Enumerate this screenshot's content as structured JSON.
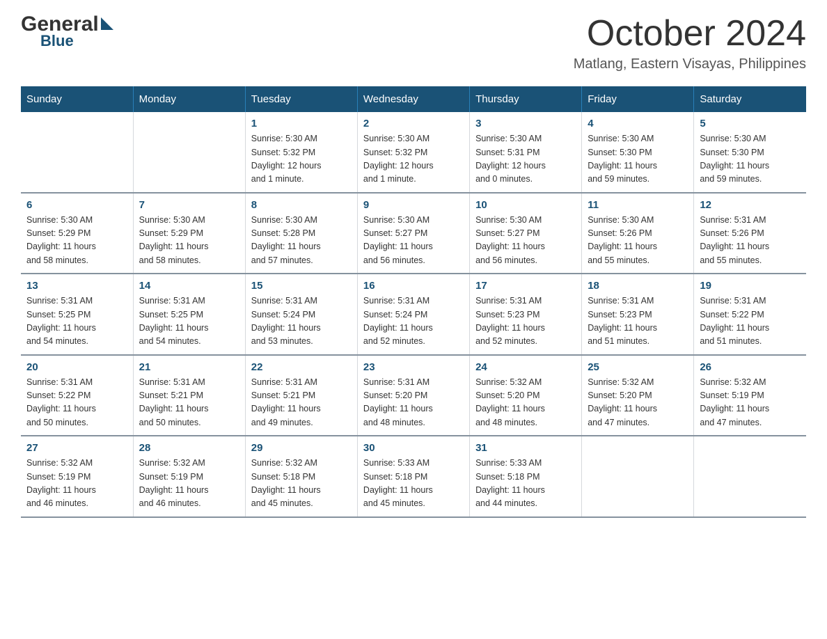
{
  "header": {
    "logo_general": "General",
    "logo_blue": "Blue",
    "month_title": "October 2024",
    "location": "Matlang, Eastern Visayas, Philippines"
  },
  "weekdays": [
    "Sunday",
    "Monday",
    "Tuesday",
    "Wednesday",
    "Thursday",
    "Friday",
    "Saturday"
  ],
  "weeks": [
    [
      {
        "day": "",
        "info": ""
      },
      {
        "day": "",
        "info": ""
      },
      {
        "day": "1",
        "info": "Sunrise: 5:30 AM\nSunset: 5:32 PM\nDaylight: 12 hours\nand 1 minute."
      },
      {
        "day": "2",
        "info": "Sunrise: 5:30 AM\nSunset: 5:32 PM\nDaylight: 12 hours\nand 1 minute."
      },
      {
        "day": "3",
        "info": "Sunrise: 5:30 AM\nSunset: 5:31 PM\nDaylight: 12 hours\nand 0 minutes."
      },
      {
        "day": "4",
        "info": "Sunrise: 5:30 AM\nSunset: 5:30 PM\nDaylight: 11 hours\nand 59 minutes."
      },
      {
        "day": "5",
        "info": "Sunrise: 5:30 AM\nSunset: 5:30 PM\nDaylight: 11 hours\nand 59 minutes."
      }
    ],
    [
      {
        "day": "6",
        "info": "Sunrise: 5:30 AM\nSunset: 5:29 PM\nDaylight: 11 hours\nand 58 minutes."
      },
      {
        "day": "7",
        "info": "Sunrise: 5:30 AM\nSunset: 5:29 PM\nDaylight: 11 hours\nand 58 minutes."
      },
      {
        "day": "8",
        "info": "Sunrise: 5:30 AM\nSunset: 5:28 PM\nDaylight: 11 hours\nand 57 minutes."
      },
      {
        "day": "9",
        "info": "Sunrise: 5:30 AM\nSunset: 5:27 PM\nDaylight: 11 hours\nand 56 minutes."
      },
      {
        "day": "10",
        "info": "Sunrise: 5:30 AM\nSunset: 5:27 PM\nDaylight: 11 hours\nand 56 minutes."
      },
      {
        "day": "11",
        "info": "Sunrise: 5:30 AM\nSunset: 5:26 PM\nDaylight: 11 hours\nand 55 minutes."
      },
      {
        "day": "12",
        "info": "Sunrise: 5:31 AM\nSunset: 5:26 PM\nDaylight: 11 hours\nand 55 minutes."
      }
    ],
    [
      {
        "day": "13",
        "info": "Sunrise: 5:31 AM\nSunset: 5:25 PM\nDaylight: 11 hours\nand 54 minutes."
      },
      {
        "day": "14",
        "info": "Sunrise: 5:31 AM\nSunset: 5:25 PM\nDaylight: 11 hours\nand 54 minutes."
      },
      {
        "day": "15",
        "info": "Sunrise: 5:31 AM\nSunset: 5:24 PM\nDaylight: 11 hours\nand 53 minutes."
      },
      {
        "day": "16",
        "info": "Sunrise: 5:31 AM\nSunset: 5:24 PM\nDaylight: 11 hours\nand 52 minutes."
      },
      {
        "day": "17",
        "info": "Sunrise: 5:31 AM\nSunset: 5:23 PM\nDaylight: 11 hours\nand 52 minutes."
      },
      {
        "day": "18",
        "info": "Sunrise: 5:31 AM\nSunset: 5:23 PM\nDaylight: 11 hours\nand 51 minutes."
      },
      {
        "day": "19",
        "info": "Sunrise: 5:31 AM\nSunset: 5:22 PM\nDaylight: 11 hours\nand 51 minutes."
      }
    ],
    [
      {
        "day": "20",
        "info": "Sunrise: 5:31 AM\nSunset: 5:22 PM\nDaylight: 11 hours\nand 50 minutes."
      },
      {
        "day": "21",
        "info": "Sunrise: 5:31 AM\nSunset: 5:21 PM\nDaylight: 11 hours\nand 50 minutes."
      },
      {
        "day": "22",
        "info": "Sunrise: 5:31 AM\nSunset: 5:21 PM\nDaylight: 11 hours\nand 49 minutes."
      },
      {
        "day": "23",
        "info": "Sunrise: 5:31 AM\nSunset: 5:20 PM\nDaylight: 11 hours\nand 48 minutes."
      },
      {
        "day": "24",
        "info": "Sunrise: 5:32 AM\nSunset: 5:20 PM\nDaylight: 11 hours\nand 48 minutes."
      },
      {
        "day": "25",
        "info": "Sunrise: 5:32 AM\nSunset: 5:20 PM\nDaylight: 11 hours\nand 47 minutes."
      },
      {
        "day": "26",
        "info": "Sunrise: 5:32 AM\nSunset: 5:19 PM\nDaylight: 11 hours\nand 47 minutes."
      }
    ],
    [
      {
        "day": "27",
        "info": "Sunrise: 5:32 AM\nSunset: 5:19 PM\nDaylight: 11 hours\nand 46 minutes."
      },
      {
        "day": "28",
        "info": "Sunrise: 5:32 AM\nSunset: 5:19 PM\nDaylight: 11 hours\nand 46 minutes."
      },
      {
        "day": "29",
        "info": "Sunrise: 5:32 AM\nSunset: 5:18 PM\nDaylight: 11 hours\nand 45 minutes."
      },
      {
        "day": "30",
        "info": "Sunrise: 5:33 AM\nSunset: 5:18 PM\nDaylight: 11 hours\nand 45 minutes."
      },
      {
        "day": "31",
        "info": "Sunrise: 5:33 AM\nSunset: 5:18 PM\nDaylight: 11 hours\nand 44 minutes."
      },
      {
        "day": "",
        "info": ""
      },
      {
        "day": "",
        "info": ""
      }
    ]
  ]
}
